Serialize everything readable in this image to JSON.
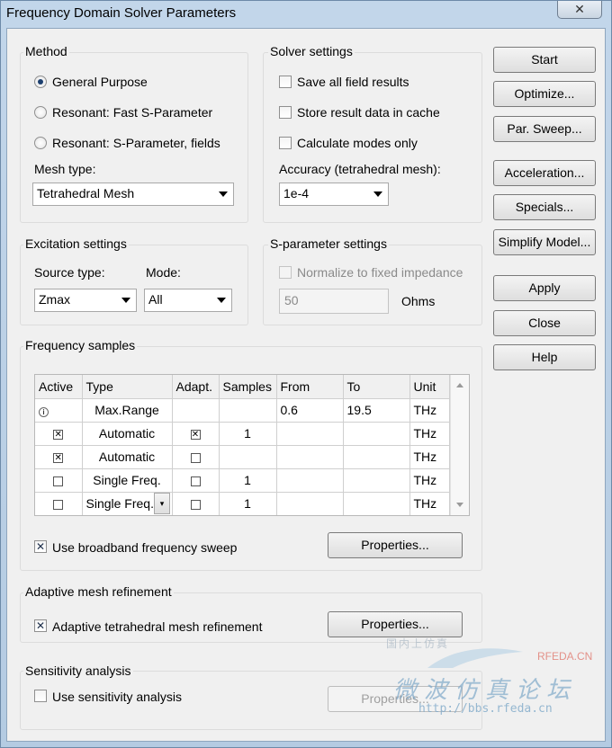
{
  "window": {
    "title": "Frequency Domain Solver Parameters",
    "close_glyph": "✕"
  },
  "method": {
    "title": "Method",
    "options": [
      "General Purpose",
      "Resonant: Fast S-Parameter",
      "Resonant: S-Parameter, fields"
    ],
    "selected": 0,
    "mesh_type_label": "Mesh type:",
    "mesh_type_value": "Tetrahedral Mesh"
  },
  "solver": {
    "title": "Solver settings",
    "save_all": "Save all field results",
    "store_cache": "Store result data in cache",
    "calc_modes": "Calculate modes only",
    "accuracy_label": "Accuracy (tetrahedral mesh):",
    "accuracy_value": "1e-4"
  },
  "excitation": {
    "title": "Excitation settings",
    "source_label": "Source type:",
    "mode_label": "Mode:",
    "source_value": "Zmax",
    "mode_value": "All"
  },
  "sparam": {
    "title": "S-parameter settings",
    "normalize_label": "Normalize to fixed impedance",
    "impedance_value": "50",
    "unit": "Ohms"
  },
  "buttons": {
    "start": "Start",
    "optimize": "Optimize...",
    "par_sweep": "Par. Sweep...",
    "acceleration": "Acceleration...",
    "specials": "Specials...",
    "simplify": "Simplify Model...",
    "apply": "Apply",
    "close": "Close",
    "help": "Help"
  },
  "freq": {
    "title": "Frequency samples",
    "columns": [
      "Active",
      "Type",
      "Adapt.",
      "Samples",
      "From",
      "To",
      "Unit"
    ],
    "rows": [
      {
        "active": "info",
        "type": "Max.Range",
        "adapt": "",
        "samples": "",
        "from": "0.6",
        "to": "19.5",
        "unit": "THz"
      },
      {
        "active": true,
        "type": "Automatic",
        "adapt": true,
        "samples": "1",
        "from": "",
        "to": "",
        "unit": "THz"
      },
      {
        "active": true,
        "type": "Automatic",
        "adapt": false,
        "samples": "",
        "from": "",
        "to": "",
        "unit": "THz"
      },
      {
        "active": false,
        "type": "Single Freq.",
        "adapt": false,
        "samples": "1",
        "from": "",
        "to": "",
        "unit": "THz"
      },
      {
        "active": false,
        "type": "Single Freq.",
        "adapt": false,
        "samples": "1",
        "from": "",
        "to": "",
        "unit": "THz"
      }
    ],
    "broadband_label": "Use broadband frequency sweep",
    "properties_label": "Properties..."
  },
  "adaptive": {
    "title": "Adaptive mesh refinement",
    "label": "Adaptive tetrahedral mesh refinement",
    "properties_label": "Properties..."
  },
  "sensitivity": {
    "title": "Sensitivity analysis",
    "label": "Use sensitivity analysis",
    "properties_label": "Properties..."
  },
  "watermark": {
    "slogan": "国内上仿真",
    "brand": "RFEDA.CN",
    "chinese": "微波仿真论坛",
    "url": "http://bbs.rfeda.cn"
  },
  "glyphs": {
    "check": "✕"
  }
}
